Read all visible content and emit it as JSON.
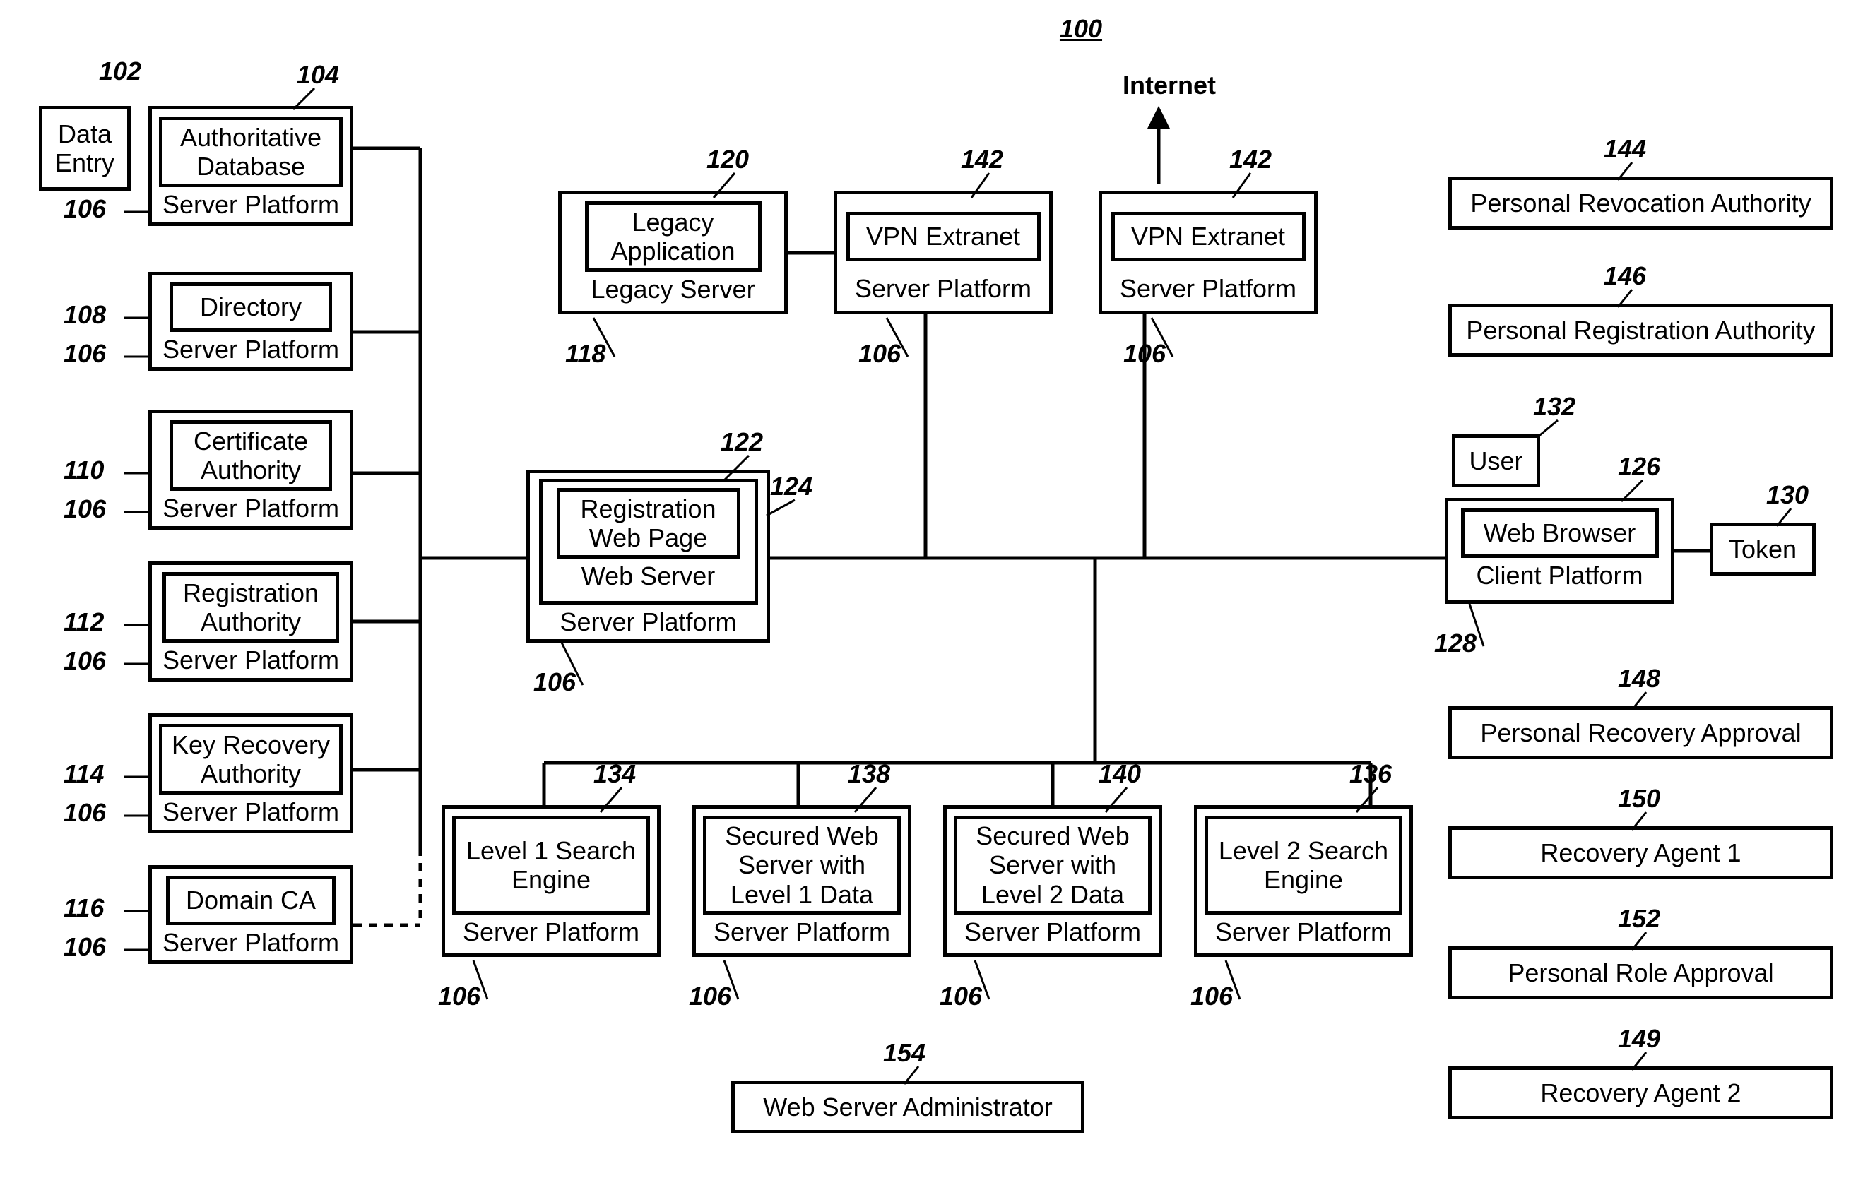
{
  "figure_ref": "100",
  "internet_label": "Internet",
  "data_entry": {
    "ref": "102",
    "label": "Data\nEntry"
  },
  "left_stack": [
    {
      "ref": "104",
      "platform_ref": "106",
      "inner": "Authoritative\nDatabase",
      "below": "Server Platform"
    },
    {
      "ref": "108",
      "platform_ref": "106",
      "inner": "Directory",
      "below": "Server Platform"
    },
    {
      "ref": "110",
      "platform_ref": "106",
      "inner": "Certificate\nAuthority",
      "below": "Server Platform"
    },
    {
      "ref": "112",
      "platform_ref": "106",
      "inner": "Registration\nAuthority",
      "below": "Server Platform"
    },
    {
      "ref": "114",
      "platform_ref": "106",
      "inner": "Key Recovery\nAuthority",
      "below": "Server Platform"
    },
    {
      "ref": "116",
      "platform_ref": "106",
      "inner": "Domain CA",
      "below": "Server Platform"
    }
  ],
  "legacy": {
    "ref_inner": "120",
    "ref_outer": "118",
    "inner": "Legacy\nApplication",
    "below": "Legacy Server"
  },
  "vpn1": {
    "ref": "142",
    "platform_ref": "106",
    "inner": "VPN Extranet",
    "below": "Server Platform"
  },
  "vpn2": {
    "ref": "142",
    "platform_ref": "106",
    "inner": "VPN Extranet",
    "below": "Server Platform"
  },
  "registration": {
    "ref_inner": "122",
    "ref_mid": "124",
    "ref_outer": "106",
    "inner": "Registration\nWeb Page",
    "mid": "Web Server",
    "below": "Server Platform"
  },
  "bottom_row": [
    {
      "ref": "134",
      "platform_ref": "106",
      "inner": "Level 1 Search\nEngine",
      "below": "Server Platform"
    },
    {
      "ref": "138",
      "platform_ref": "106",
      "inner": "Secured Web\nServer with\nLevel 1 Data",
      "below": "Server Platform"
    },
    {
      "ref": "140",
      "platform_ref": "106",
      "inner": "Secured Web\nServer with\nLevel 2 Data",
      "below": "Server Platform"
    },
    {
      "ref": "136",
      "platform_ref": "106",
      "inner": "Level 2 Search\nEngine",
      "below": "Server Platform"
    }
  ],
  "web_admin": {
    "ref": "154",
    "label": "Web Server Administrator"
  },
  "user": {
    "ref": "132",
    "label": "User"
  },
  "client": {
    "ref_inner": "126",
    "ref_outer": "128",
    "inner": "Web Browser",
    "below": "Client Platform"
  },
  "token": {
    "ref": "130",
    "label": "Token"
  },
  "right_stack": [
    {
      "ref": "144",
      "label": "Personal Revocation Authority"
    },
    {
      "ref": "146",
      "label": "Personal Registration Authority"
    },
    {
      "ref": "148",
      "label": "Personal Recovery Approval"
    },
    {
      "ref": "150",
      "label": "Recovery Agent 1"
    },
    {
      "ref": "152",
      "label": "Personal Role Approval"
    },
    {
      "ref": "149",
      "label": "Recovery Agent 2"
    }
  ]
}
